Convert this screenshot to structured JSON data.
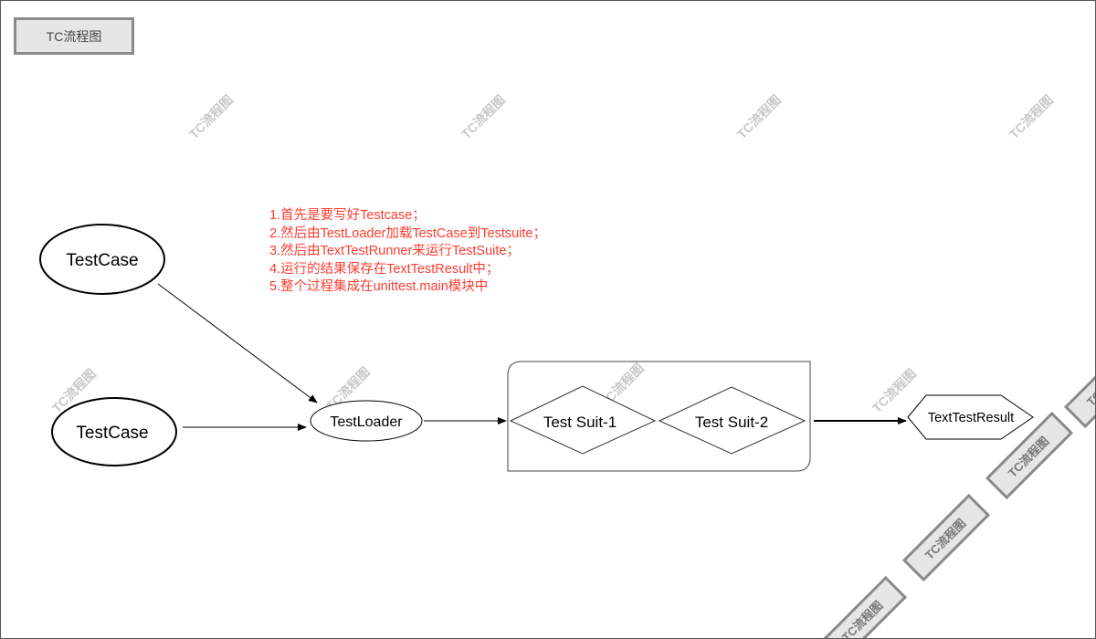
{
  "title": "TC流程图",
  "watermark": "TC流程图",
  "notes": [
    "1.首先是要写好Testcase；",
    "2.然后由TestLoader加载TestCase到Testsuite；",
    "3.然后由TextTestRunner来运行TestSuite；",
    "4.运行的结果保存在TextTestResult中；",
    "5.整个过程集成在unittest.main模块中"
  ],
  "nodes": {
    "testcase_1": "TestCase",
    "testcase_2": "TestCase",
    "testloader": "TestLoader",
    "suite_1": "Test Suit-1",
    "suite_2": "Test Suit-2",
    "result": "TextTestResult"
  },
  "colors": {
    "notes": "#ff3b30",
    "stamp_fill": "#e6e6e6",
    "stamp_border": "#8a8a8a"
  }
}
